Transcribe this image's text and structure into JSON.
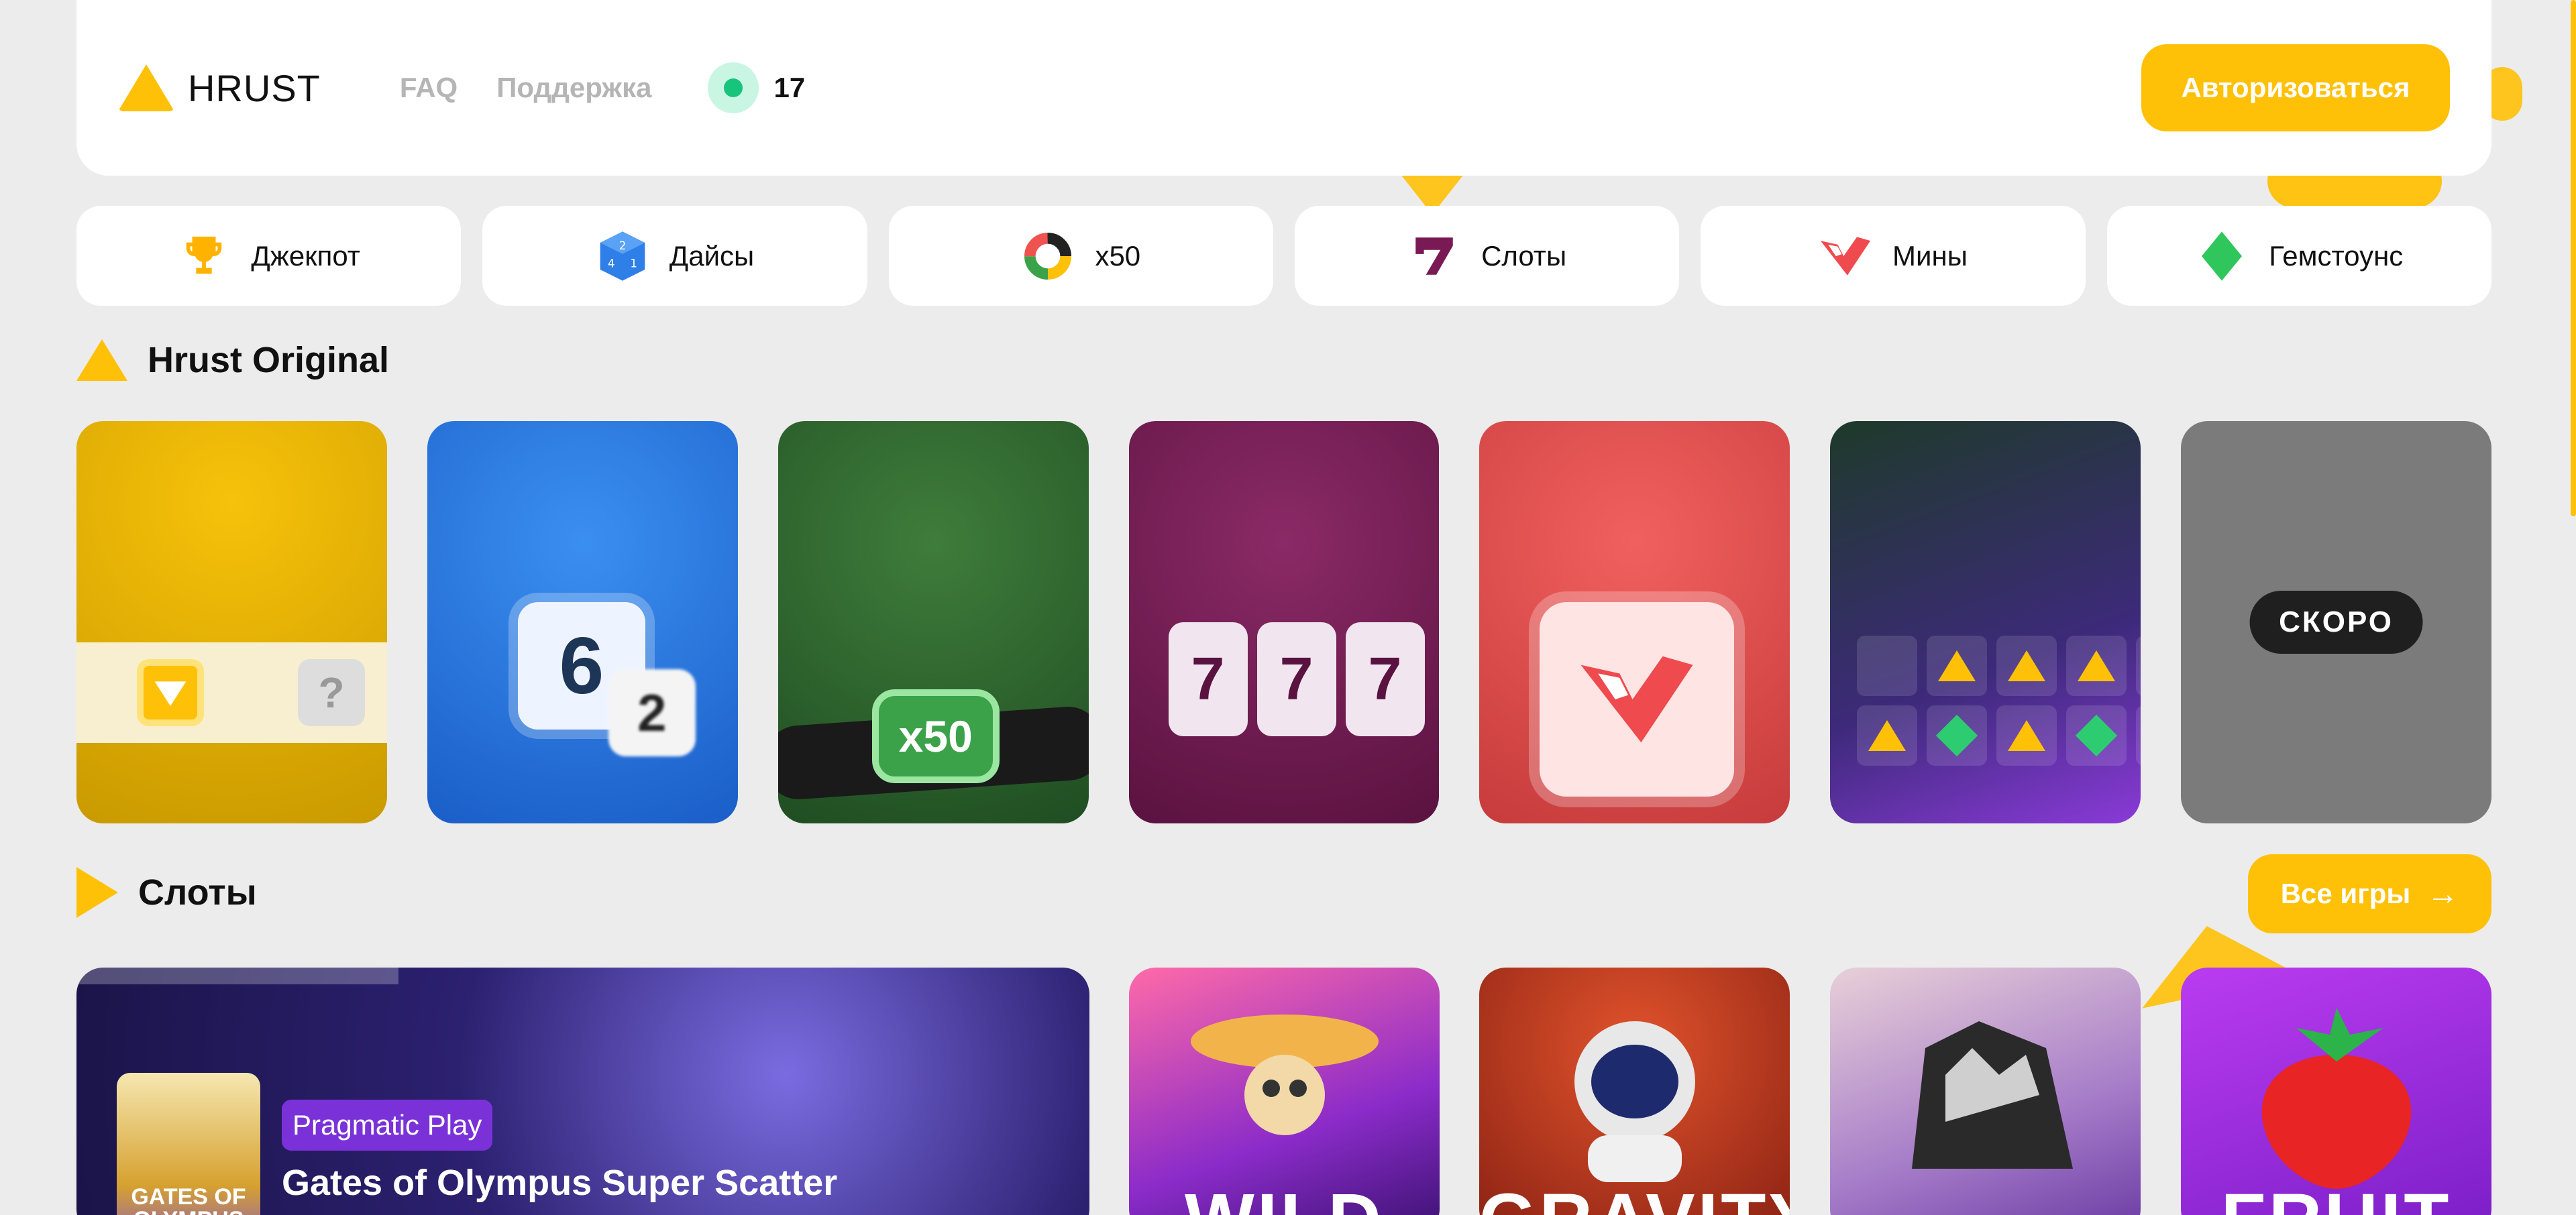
{
  "header": {
    "logo_text": "HRUST",
    "nav": [
      "FAQ",
      "Поддержка"
    ],
    "online_count": "17",
    "login_label": "Авторизоваться"
  },
  "categories": [
    {
      "label": "Джекпот",
      "icon": "trophy-icon"
    },
    {
      "label": "Дайсы",
      "icon": "dice-icon"
    },
    {
      "label": "x50",
      "icon": "wheel-icon"
    },
    {
      "label": "Слоты",
      "icon": "seven-icon"
    },
    {
      "label": "Мины",
      "icon": "mines-icon"
    },
    {
      "label": "Гемстоунс",
      "icon": "gem-icon"
    }
  ],
  "originals": {
    "title": "Hrust Original",
    "soon_label": "СКОРО",
    "dice_big": "6",
    "dice_small": "2",
    "x50_badge": "x50",
    "reels": [
      "7",
      "7",
      "7"
    ],
    "strip_question": "?"
  },
  "slots": {
    "title": "Слоты",
    "all_games_label": "Все игры",
    "featured": {
      "provider": "Pragmatic Play",
      "title": "Gates of Olympus Super Scatter",
      "thumb_text": "GATES OF OLYMPUS SUPER"
    },
    "cards": [
      "WILD",
      "GRAVITY",
      "",
      "FRUIT"
    ]
  },
  "colors": {
    "accent": "#ffc107",
    "online": "#17c47c",
    "background": "#ececec"
  }
}
